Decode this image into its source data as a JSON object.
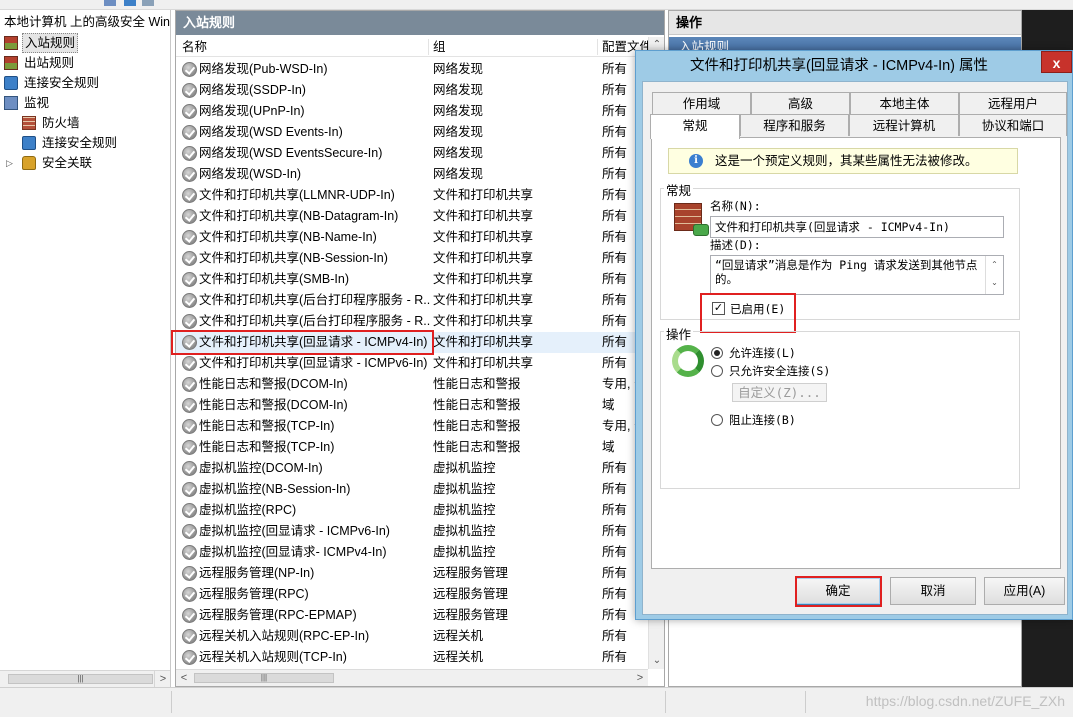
{
  "tree": {
    "header": "本地计算机 上的高级安全 Win",
    "items": [
      {
        "label": "入站规则",
        "icon": "firewall-inbound-icon",
        "selected": true
      },
      {
        "label": "出站规则",
        "icon": "firewall-outbound-icon"
      },
      {
        "label": "连接安全规则",
        "icon": "connection-security-icon"
      },
      {
        "label": "监视",
        "icon": "monitor-icon"
      },
      {
        "label": "防火墙",
        "icon": "firewall-wall-icon"
      },
      {
        "label": "连接安全规则",
        "icon": "connection-security-icon"
      },
      {
        "label": "安全关联",
        "icon": "lock-icon"
      }
    ]
  },
  "center": {
    "title": "入站规则",
    "columns": [
      "名称",
      "组",
      "配置文件"
    ],
    "rows": [
      {
        "name": "网络发现(Pub-WSD-In)",
        "group": "网络发现",
        "profile": "所有"
      },
      {
        "name": "网络发现(SSDP-In)",
        "group": "网络发现",
        "profile": "所有"
      },
      {
        "name": "网络发现(UPnP-In)",
        "group": "网络发现",
        "profile": "所有"
      },
      {
        "name": "网络发现(WSD Events-In)",
        "group": "网络发现",
        "profile": "所有"
      },
      {
        "name": "网络发现(WSD EventsSecure-In)",
        "group": "网络发现",
        "profile": "所有"
      },
      {
        "name": "网络发现(WSD-In)",
        "group": "网络发现",
        "profile": "所有"
      },
      {
        "name": "文件和打印机共享(LLMNR-UDP-In)",
        "group": "文件和打印机共享",
        "profile": "所有"
      },
      {
        "name": "文件和打印机共享(NB-Datagram-In)",
        "group": "文件和打印机共享",
        "profile": "所有"
      },
      {
        "name": "文件和打印机共享(NB-Name-In)",
        "group": "文件和打印机共享",
        "profile": "所有"
      },
      {
        "name": "文件和打印机共享(NB-Session-In)",
        "group": "文件和打印机共享",
        "profile": "所有"
      },
      {
        "name": "文件和打印机共享(SMB-In)",
        "group": "文件和打印机共享",
        "profile": "所有"
      },
      {
        "name": "文件和打印机共享(后台打印程序服务 - R...",
        "group": "文件和打印机共享",
        "profile": "所有"
      },
      {
        "name": "文件和打印机共享(后台打印程序服务 - R...",
        "group": "文件和打印机共享",
        "profile": "所有"
      },
      {
        "name": "文件和打印机共享(回显请求 - ICMPv4-In)",
        "group": "文件和打印机共享",
        "profile": "所有",
        "selected": true
      },
      {
        "name": "文件和打印机共享(回显请求 - ICMPv6-In)",
        "group": "文件和打印机共享",
        "profile": "所有"
      },
      {
        "name": "性能日志和警报(DCOM-In)",
        "group": "性能日志和警报",
        "profile": "专用, 公"
      },
      {
        "name": "性能日志和警报(DCOM-In)",
        "group": "性能日志和警报",
        "profile": "域"
      },
      {
        "name": "性能日志和警报(TCP-In)",
        "group": "性能日志和警报",
        "profile": "专用, 公"
      },
      {
        "name": "性能日志和警报(TCP-In)",
        "group": "性能日志和警报",
        "profile": "域"
      },
      {
        "name": "虚拟机监控(DCOM-In)",
        "group": "虚拟机监控",
        "profile": "所有"
      },
      {
        "name": "虚拟机监控(NB-Session-In)",
        "group": "虚拟机监控",
        "profile": "所有"
      },
      {
        "name": "虚拟机监控(RPC)",
        "group": "虚拟机监控",
        "profile": "所有"
      },
      {
        "name": "虚拟机监控(回显请求 - ICMPv6-In)",
        "group": "虚拟机监控",
        "profile": "所有"
      },
      {
        "name": "虚拟机监控(回显请求- ICMPv4-In)",
        "group": "虚拟机监控",
        "profile": "所有"
      },
      {
        "name": "远程服务管理(NP-In)",
        "group": "远程服务管理",
        "profile": "所有"
      },
      {
        "name": "远程服务管理(RPC)",
        "group": "远程服务管理",
        "profile": "所有"
      },
      {
        "name": "远程服务管理(RPC-EPMAP)",
        "group": "远程服务管理",
        "profile": "所有"
      },
      {
        "name": "远程关机入站规则(RPC-EP-In)",
        "group": "远程关机",
        "profile": "所有"
      },
      {
        "name": "远程关机入站规则(TCP-In)",
        "group": "远程关机",
        "profile": "所有"
      }
    ]
  },
  "actions": {
    "title": "操作",
    "subtitle": "入站规则"
  },
  "dialog": {
    "title": "文件和打印机共享(回显请求 - ICMPv4-In) 属性",
    "close_label": "x",
    "tabs_row1": [
      "作用域",
      "高级",
      "本地主体",
      "远程用户"
    ],
    "tabs_row2": [
      "常规",
      "程序和服务",
      "远程计算机",
      "协议和端口"
    ],
    "active_tab": "常规",
    "info_text": "这是一个预定义规则，其某些属性无法被修改。",
    "general": {
      "group_label": "常规",
      "name_label": "名称(N):",
      "name_value": "文件和打印机共享(回显请求 - ICMPv4-In)",
      "desc_label": "描述(D):",
      "desc_value": "“回显请求”消息是作为 Ping 请求发送到其他节点的。",
      "enabled_label": "已启用(E)",
      "enabled": true
    },
    "action": {
      "group_label": "操作",
      "allow_label": "允许连接(L)",
      "allow_secure_label": "只允许安全连接(S)",
      "customize_label": "自定义(Z)...",
      "block_label": "阻止连接(B)",
      "selected": "allow"
    },
    "buttons": {
      "ok": "确定",
      "cancel": "取消",
      "apply": "应用(A)"
    }
  },
  "watermark": "https://blog.csdn.net/ZUFE_ZXh",
  "colors": {
    "highlight": "#e02020",
    "title_bar": "#9ecbe6",
    "pane_header": "#7a8a99"
  }
}
